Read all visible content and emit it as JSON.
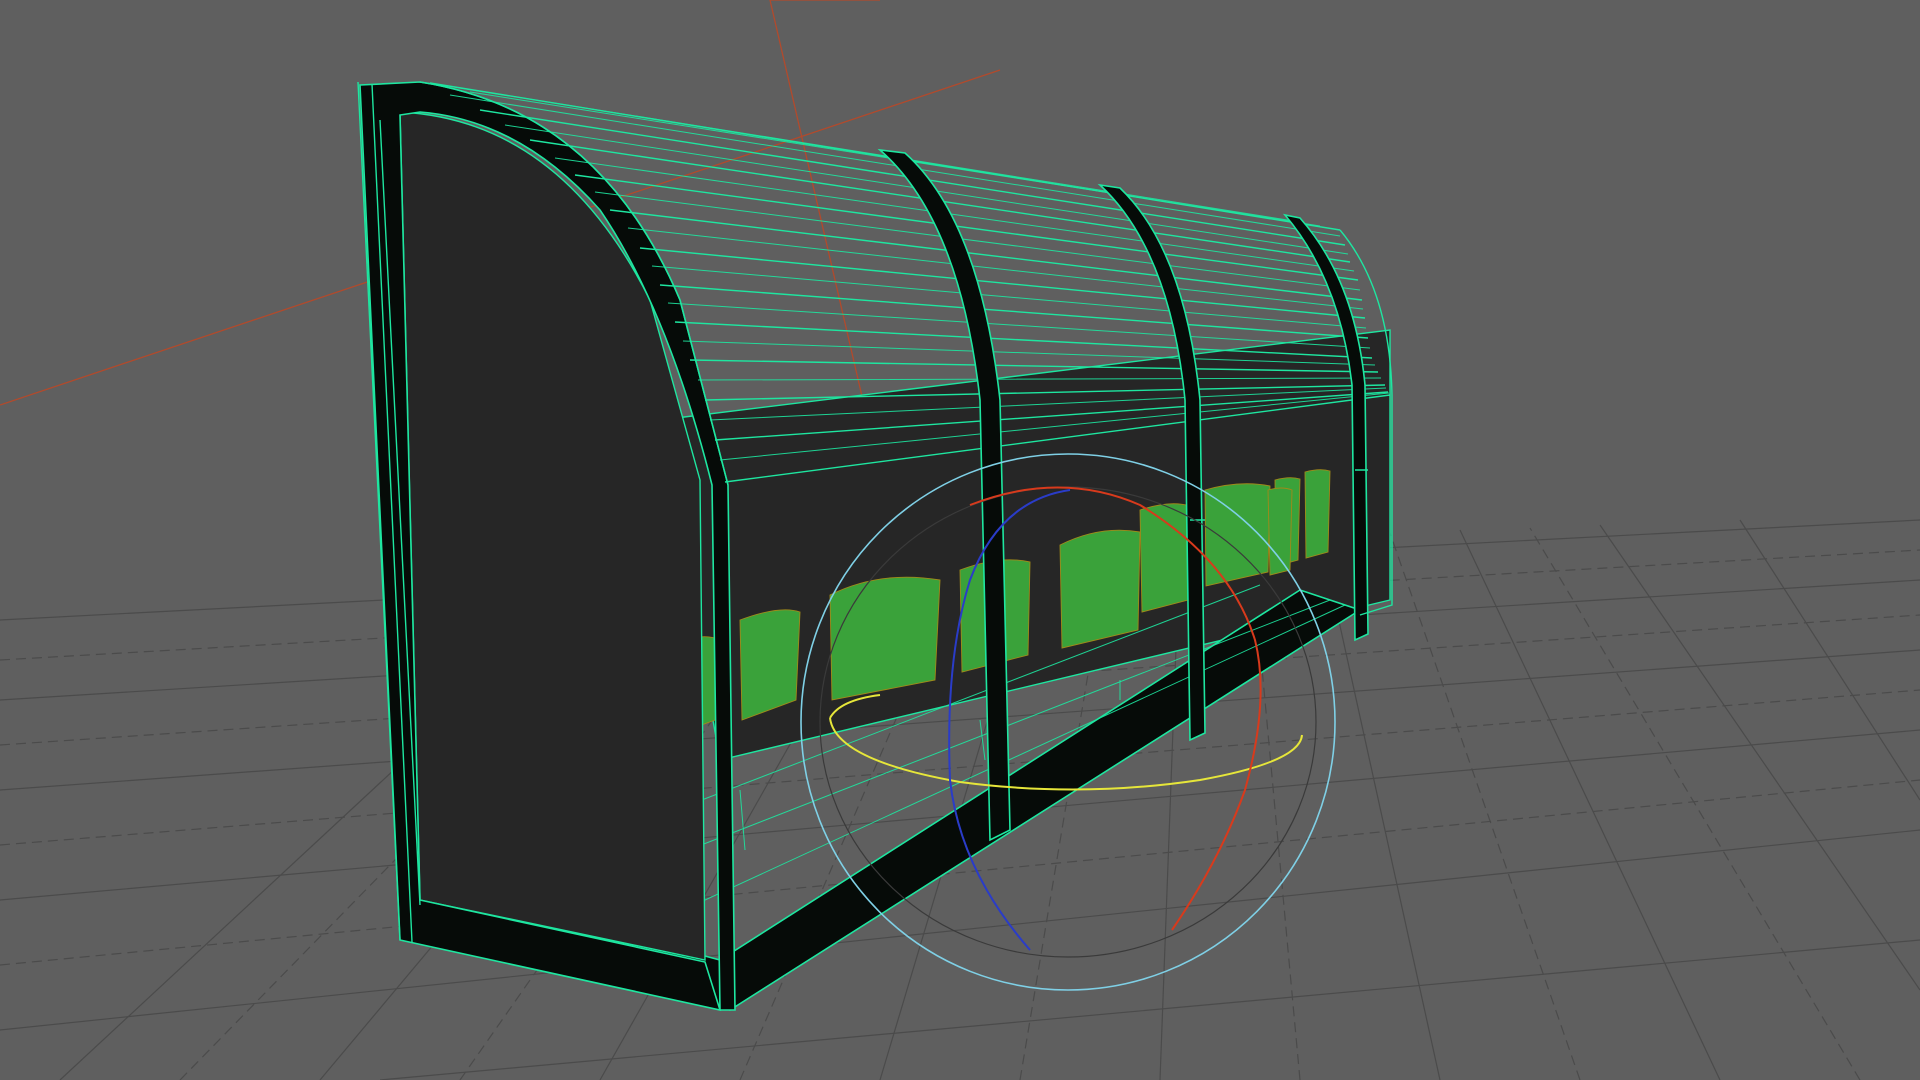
{
  "viewport": {
    "background_color": "#5f5f5f",
    "grid_color": "#4b4b4b",
    "world_axis_color": "#b24a2c",
    "wireframe_color": "#1ee6a0",
    "seat_color": "#3e9a35"
  },
  "model": {
    "type": "covered-bench-dugout",
    "seat_count": 10
  },
  "rotate_gizmo": {
    "x_axis_color": "#d83a1c",
    "y_axis_color": "#e6e63a",
    "z_axis_color": "#2a3cc8",
    "screen_ring_color": "#7fd0e6"
  }
}
